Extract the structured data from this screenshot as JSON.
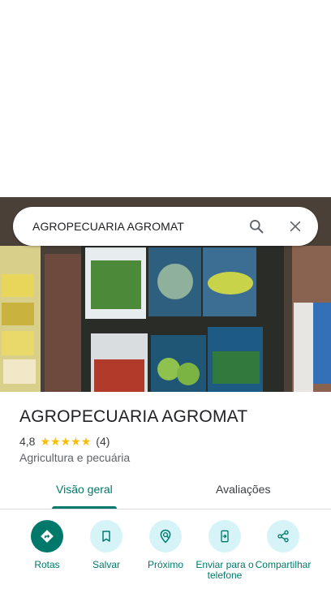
{
  "search": {
    "query": "AGROPECUARIA AGROMAT"
  },
  "place": {
    "name": "AGROPECUARIA AGROMAT",
    "rating": "4,8",
    "stars": 5,
    "review_count": "(4)",
    "category": "Agricultura e pecuária"
  },
  "tabs": [
    {
      "label": "Visão geral",
      "selected": true
    },
    {
      "label": "Avaliações",
      "selected": false
    }
  ],
  "actions": [
    {
      "label": "Rotas",
      "icon": "directions-icon"
    },
    {
      "label": "Salvar",
      "icon": "bookmark-icon"
    },
    {
      "label": "Próximo",
      "icon": "nearby-icon"
    },
    {
      "label": "Enviar para o telefone",
      "icon": "send-to-phone-icon"
    },
    {
      "label": "Compartilhar",
      "icon": "share-icon"
    }
  ],
  "colors": {
    "accent": "#00796b",
    "accent_light": "#d6f4f8",
    "star": "#fbbc04"
  }
}
